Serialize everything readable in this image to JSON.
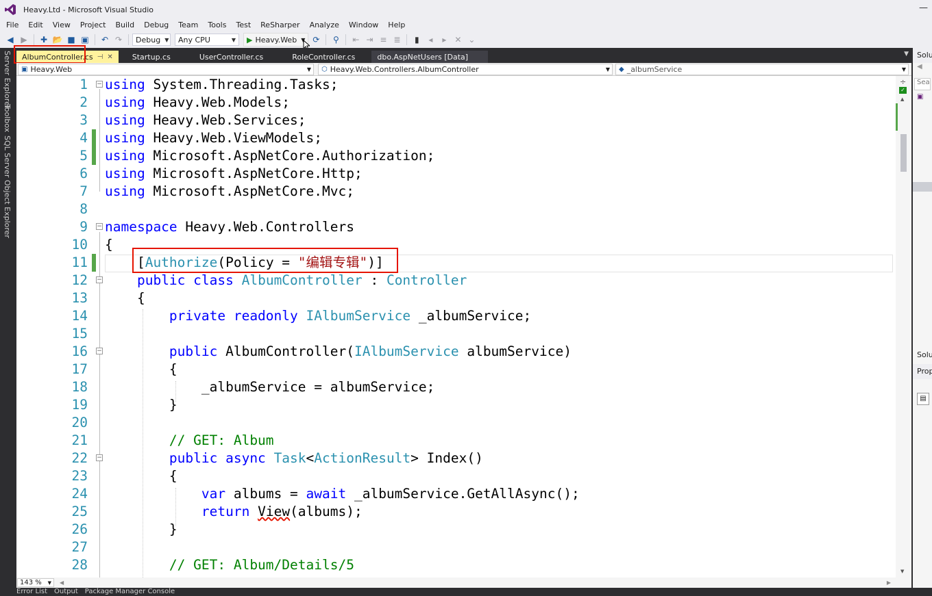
{
  "window": {
    "title": "Heavy.Ltd - Microsoft Visual Studio"
  },
  "menu": [
    "File",
    "Edit",
    "View",
    "Project",
    "Build",
    "Debug",
    "Team",
    "Tools",
    "Test",
    "ReSharper",
    "Analyze",
    "Window",
    "Help"
  ],
  "toolbar": {
    "config": "Debug",
    "platform": "Any CPU",
    "run_target": "Heavy.Web"
  },
  "left_dock": [
    "Server Explorer",
    "Toolbox",
    "SQL Server Object Explorer"
  ],
  "tabs": [
    {
      "label": "AlbumController.cs",
      "active": true
    },
    {
      "label": "Startup.cs"
    },
    {
      "label": "UserController.cs"
    },
    {
      "label": "RoleController.cs"
    },
    {
      "label": "dbo.AspNetUsers [Data]"
    }
  ],
  "navbar": {
    "project": "Heavy.Web",
    "type": "Heavy.Web.Controllers.AlbumController",
    "member": "_albumService"
  },
  "code_lines": [
    {
      "n": "1",
      "parts": [
        [
          "kw",
          "using"
        ],
        [
          "pl",
          " System.Threading.Tasks;"
        ]
      ]
    },
    {
      "n": "2",
      "parts": [
        [
          "kw",
          "using"
        ],
        [
          "pl",
          " Heavy.Web.Models;"
        ]
      ]
    },
    {
      "n": "3",
      "parts": [
        [
          "kw",
          "using"
        ],
        [
          "pl",
          " Heavy.Web.Services;"
        ]
      ]
    },
    {
      "n": "4",
      "parts": [
        [
          "kw",
          "using"
        ],
        [
          "pl",
          " Heavy.Web.ViewModels;"
        ]
      ]
    },
    {
      "n": "5",
      "parts": [
        [
          "kw",
          "using"
        ],
        [
          "pl",
          " Microsoft.AspNetCore.Authorization;"
        ]
      ]
    },
    {
      "n": "6",
      "parts": [
        [
          "kw",
          "using"
        ],
        [
          "pl",
          " Microsoft.AspNetCore.Http;"
        ]
      ]
    },
    {
      "n": "7",
      "parts": [
        [
          "kw",
          "using"
        ],
        [
          "pl",
          " Microsoft.AspNetCore.Mvc;"
        ]
      ]
    },
    {
      "n": "8",
      "parts": []
    },
    {
      "n": "9",
      "parts": [
        [
          "kw",
          "namespace"
        ],
        [
          "pl",
          " Heavy.Web.Controllers"
        ]
      ]
    },
    {
      "n": "10",
      "parts": [
        [
          "pl",
          "{"
        ]
      ]
    },
    {
      "n": "11",
      "parts": [
        [
          "pl",
          "    ["
        ],
        [
          "ty",
          "Authorize"
        ],
        [
          "pl",
          "(Policy = "
        ],
        [
          "st",
          "\"编辑专辑\""
        ],
        [
          "pl",
          ")]"
        ]
      ]
    },
    {
      "n": "12",
      "parts": [
        [
          "pl",
          "    "
        ],
        [
          "kw",
          "public class"
        ],
        [
          "pl",
          " "
        ],
        [
          "ty",
          "AlbumController"
        ],
        [
          "pl",
          " : "
        ],
        [
          "ty",
          "Controller"
        ]
      ]
    },
    {
      "n": "13",
      "parts": [
        [
          "pl",
          "    {"
        ]
      ]
    },
    {
      "n": "14",
      "parts": [
        [
          "pl",
          "        "
        ],
        [
          "kw",
          "private readonly"
        ],
        [
          "pl",
          " "
        ],
        [
          "ty",
          "IAlbumService"
        ],
        [
          "pl",
          " _albumService;"
        ]
      ]
    },
    {
      "n": "15",
      "parts": []
    },
    {
      "n": "16",
      "parts": [
        [
          "pl",
          "        "
        ],
        [
          "kw",
          "public"
        ],
        [
          "pl",
          " AlbumController("
        ],
        [
          "ty",
          "IAlbumService"
        ],
        [
          "pl",
          " albumService)"
        ]
      ]
    },
    {
      "n": "17",
      "parts": [
        [
          "pl",
          "        {"
        ]
      ]
    },
    {
      "n": "18",
      "parts": [
        [
          "pl",
          "            _albumService = albumService;"
        ]
      ]
    },
    {
      "n": "19",
      "parts": [
        [
          "pl",
          "        }"
        ]
      ]
    },
    {
      "n": "20",
      "parts": []
    },
    {
      "n": "21",
      "parts": [
        [
          "pl",
          "        "
        ],
        [
          "cm",
          "// GET: Album"
        ]
      ]
    },
    {
      "n": "22",
      "parts": [
        [
          "pl",
          "        "
        ],
        [
          "kw",
          "public async"
        ],
        [
          "pl",
          " "
        ],
        [
          "ty",
          "Task"
        ],
        [
          "pl",
          "<"
        ],
        [
          "ty",
          "ActionResult"
        ],
        [
          "pl",
          "> Index()"
        ]
      ]
    },
    {
      "n": "23",
      "parts": [
        [
          "pl",
          "        {"
        ]
      ]
    },
    {
      "n": "24",
      "parts": [
        [
          "pl",
          "            "
        ],
        [
          "kw",
          "var"
        ],
        [
          "pl",
          " albums = "
        ],
        [
          "kw",
          "await"
        ],
        [
          "pl",
          " _albumService.GetAllAsync();"
        ]
      ]
    },
    {
      "n": "25",
      "parts": [
        [
          "pl",
          "            "
        ],
        [
          "kw",
          "return"
        ],
        [
          "pl",
          " "
        ],
        [
          "sq",
          "View"
        ],
        [
          "pl",
          "(albums);"
        ]
      ]
    },
    {
      "n": "26",
      "parts": [
        [
          "pl",
          "        }"
        ]
      ]
    },
    {
      "n": "27",
      "parts": []
    },
    {
      "n": "28",
      "parts": [
        [
          "pl",
          "        "
        ],
        [
          "cm",
          "// GET: Album/Details/5"
        ]
      ]
    }
  ],
  "zoom": "143 %",
  "bottom_tabs": [
    "Error List",
    "Output",
    "Package Manager Console"
  ],
  "right_panel": {
    "solution": "Solu",
    "search": "Sear",
    "solution2": "Solu",
    "properties": "Prop"
  },
  "colors": {
    "keyword": "#0000ff",
    "type": "#2b91af",
    "string": "#a31515",
    "comment": "#008000",
    "highlight": "#e51400",
    "active_tab": "#fff29d"
  }
}
